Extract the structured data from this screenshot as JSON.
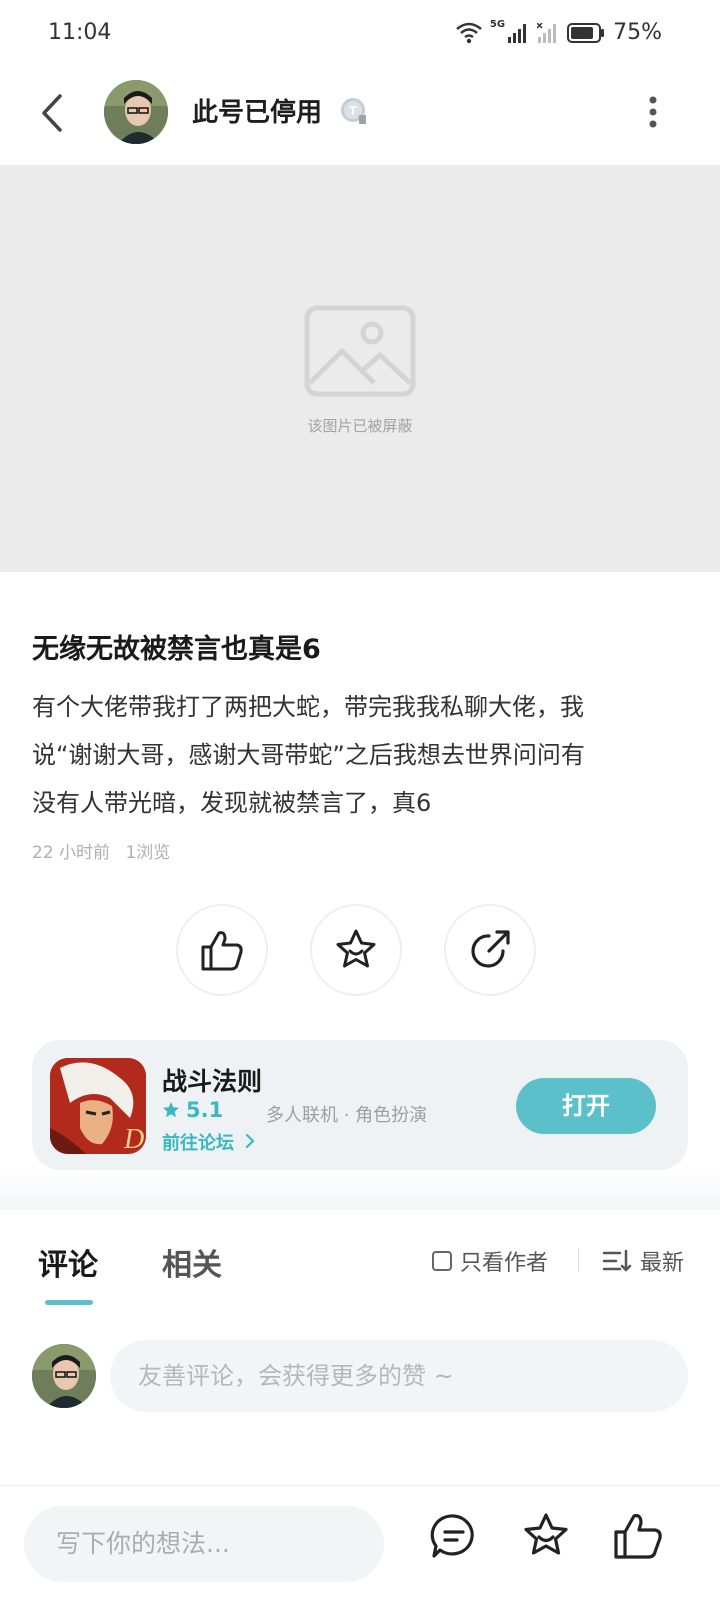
{
  "status_bar": {
    "time": "11:04",
    "network": "5G",
    "battery": "75%",
    "icons": [
      "wifi-icon",
      "signal-icon",
      "signal-no-service-icon",
      "battery-icon"
    ]
  },
  "header": {
    "title": "此号已停用",
    "badge": "T",
    "icons": [
      "back-arrow-icon",
      "more-vertical-icon"
    ]
  },
  "image": {
    "caption": "该图片已被屏蔽",
    "icon": "image-placeholder-icon"
  },
  "post": {
    "title": "无缘无故被禁言也真是6",
    "body_lines": [
      "有个大佬带我打了两把大蛇，带完我我私聊大佬，我",
      "说“谢谢大哥，感谢大哥带蛇”之后我想去世界问问有",
      "没有人带光暗，发现就被禁言了，真6"
    ],
    "time": "22 小时前",
    "views": "1浏览"
  },
  "actions": [
    "thumbs-up-icon",
    "star-icon",
    "share-icon"
  ],
  "game_card": {
    "name": "战斗法则",
    "rating": "5.1",
    "tags": "多人联机 · 角色扮演",
    "forum_link": "前往论坛",
    "open_label": "打开",
    "accent": "#5bc0c9"
  },
  "comments": {
    "tab_comments": "评论",
    "tab_related": "相关",
    "only_author": "只看作者",
    "sort": "最新",
    "input_placeholder": "友善评论，会获得更多的赞 ~"
  },
  "bottom_bar": {
    "input_placeholder": "写下你的想法...",
    "icons": [
      "comment-icon",
      "star-icon",
      "thumbs-up-icon"
    ]
  }
}
